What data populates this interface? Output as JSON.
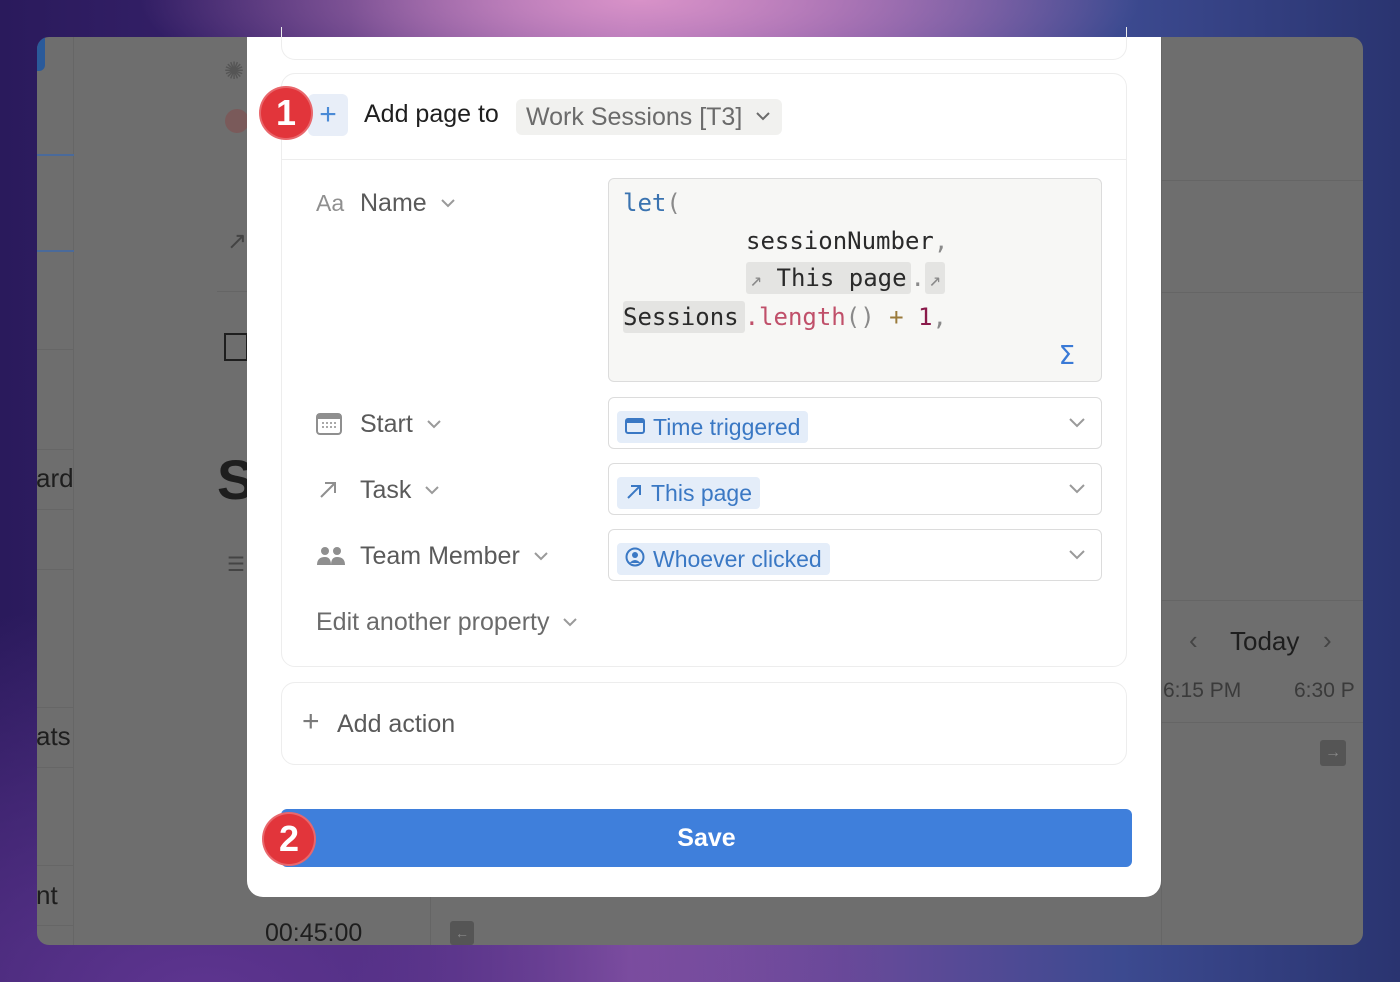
{
  "background_app": {
    "sidebar_fragments": [
      "ards",
      "ats",
      "nt"
    ],
    "page_title_fragment": "S",
    "calendar": {
      "nav_label": "Today",
      "times": [
        "6:15 PM",
        "6:30 P"
      ]
    },
    "duration": "00:45:00"
  },
  "modal": {
    "action": {
      "add_page_label": "Add page to",
      "database": "Work Sessions [T3]",
      "properties": [
        {
          "icon": "text-icon",
          "icon_glyph": "Aa",
          "label": "Name"
        },
        {
          "icon": "calendar-icon",
          "label": "Start",
          "value": "Time triggered",
          "value_icon": "calendar-icon"
        },
        {
          "icon": "relation-arrow-icon",
          "label": "Task",
          "value": "This page",
          "value_icon": "relation-arrow-icon"
        },
        {
          "icon": "people-icon",
          "label": "Team Member",
          "value": "Whoever clicked",
          "value_icon": "user-circle-icon"
        }
      ],
      "formula": {
        "line1_kw": "let",
        "line1_paren": "(",
        "line2": "sessionNumber",
        "line2_punct": ",",
        "mention1": "This page",
        "mention_sep": ".",
        "mention2": "Sessions",
        "method": ".length",
        "call": "()",
        "op": "+",
        "num": "1",
        "trail": ",",
        "sigma": "Σ"
      },
      "edit_another_label": "Edit another property"
    },
    "add_action_label": "Add action",
    "save_label": "Save"
  },
  "annotations": {
    "step1": "1",
    "step2": "2"
  },
  "colors": {
    "accent": "#3f7fdb",
    "badge": "#e2353b",
    "chip_bg": "#e4edf9",
    "chip_text": "#3a78c4"
  }
}
